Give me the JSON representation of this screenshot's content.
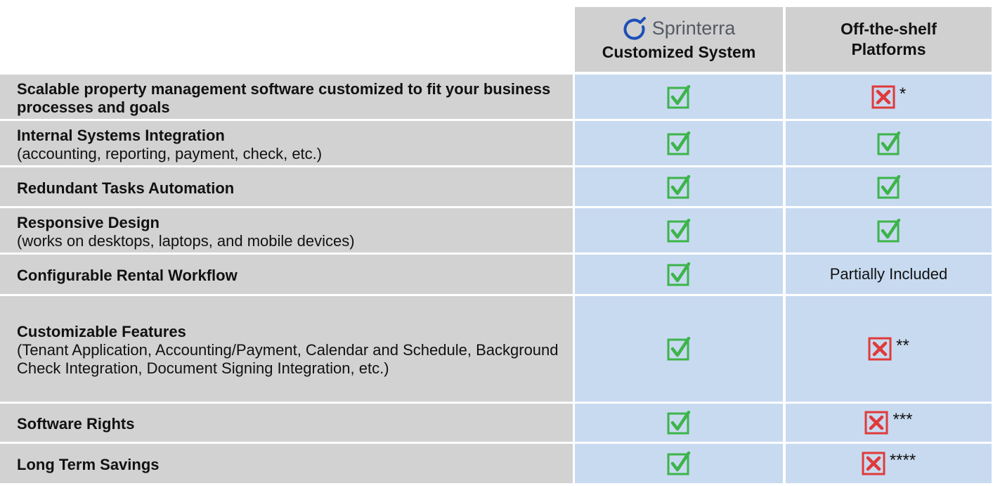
{
  "header": {
    "brand_name": "Sprinterra",
    "col_customized": "Customized System",
    "col_offshelf_line1": "Off-the-shelf",
    "col_offshelf_line2": "Platforms"
  },
  "colors": {
    "check_green": "#3cb44a",
    "cross_red": "#e03a3a",
    "cell_blue": "#c8daf0",
    "cell_grey": "#d2d2d2",
    "logo_blue": "#1e4fb8"
  },
  "rows": [
    {
      "title": "Scalable property management software customized to fit your business processes and goals",
      "sub": "",
      "custom": "check",
      "offshelf": "cross",
      "note": "*"
    },
    {
      "title": "Internal Systems Integration",
      "sub": "(accounting, reporting, payment, check, etc.)",
      "custom": "check",
      "offshelf": "check",
      "note": ""
    },
    {
      "title": "Redundant Tasks Automation",
      "sub": "",
      "custom": "check",
      "offshelf": "check",
      "note": ""
    },
    {
      "title": "Responsive Design",
      "sub": "(works on desktops, laptops, and mobile devices)",
      "custom": "check",
      "offshelf": "check",
      "note": ""
    },
    {
      "title": "Configurable Rental Workflow",
      "sub": "",
      "custom": "check",
      "offshelf": "text",
      "note": "Partially Included"
    },
    {
      "title": "Customizable Features",
      "sub": "(Tenant Application, Accounting/Payment, Calendar and Schedule, Background Check Integration, Document Signing Integration, etc.)",
      "custom": "check",
      "offshelf": "cross",
      "note": "**"
    },
    {
      "title": "Software Rights",
      "sub": "",
      "custom": "check",
      "offshelf": "cross",
      "note": "***"
    },
    {
      "title": "Long Term Savings",
      "sub": "",
      "custom": "check",
      "offshelf": "cross",
      "note": "****"
    }
  ]
}
